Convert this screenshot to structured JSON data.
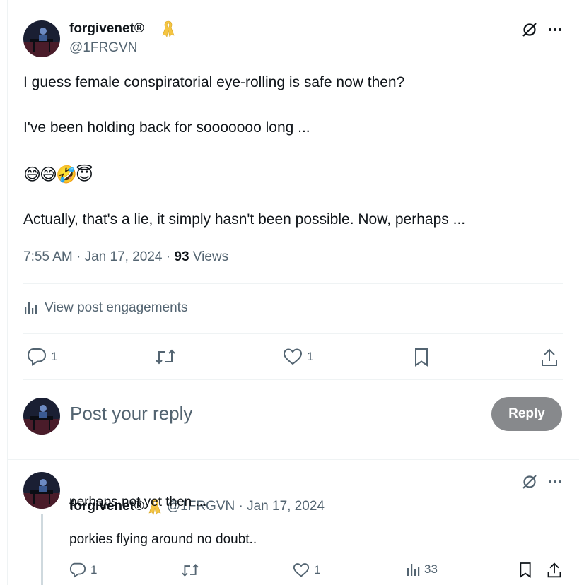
{
  "main_post": {
    "author_name": "forgivenet®",
    "handle": "@1FRGVN",
    "lines": {
      "l1": "I guess female conspiratorial eye-rolling is safe now then?",
      "l2": "I've been holding back for sooooooo long ...",
      "emojis": "😅😅🤣😇",
      "l3": "Actually, that's a lie, it simply hasn't been possible. Now, perhaps ..."
    },
    "time": "7:55 AM",
    "date": "Jan 17, 2024",
    "views_count": "93",
    "views_label": "Views",
    "engagements_label": "View post engagements",
    "actions": {
      "reply_count": "1",
      "like_count": "1"
    }
  },
  "reply_box": {
    "placeholder": "Post your reply",
    "button_label": "Reply"
  },
  "reply_post": {
    "author_name": "forgivenet®",
    "handle": "@1FRGVN",
    "date": "Jan 17, 2024",
    "line1": "perhaps not yet then ...",
    "line2": "porkies flying around no doubt..",
    "actions": {
      "reply_count": "1",
      "like_count": "1",
      "views_count": "33"
    }
  },
  "colors": {
    "text": "#0f1419",
    "muted": "#536471",
    "separator": "#eff3f4",
    "reply_button": "#87898c",
    "ribbon": "#f5c542"
  },
  "icons": [
    "grok-icon",
    "more-icon",
    "ribbon-icon",
    "analytics-icon",
    "reply-icon",
    "retweet-icon",
    "like-icon",
    "bookmark-icon",
    "share-icon"
  ]
}
